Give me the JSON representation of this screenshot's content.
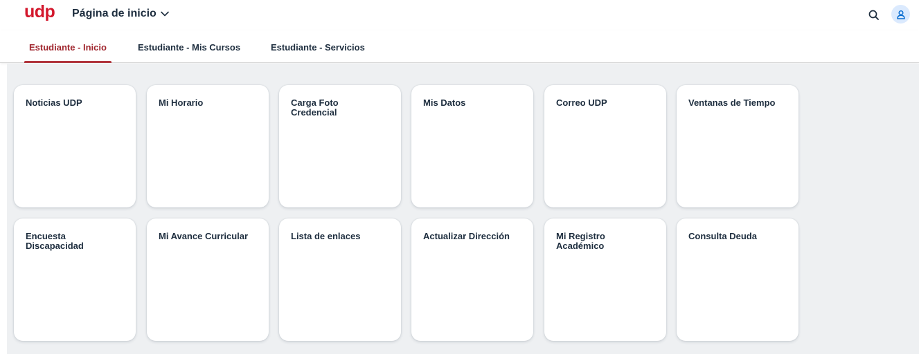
{
  "header": {
    "logo_text": "udp",
    "app_title": "Página de inicio",
    "brand_color": "#d3172c",
    "search_icon": "search-icon",
    "user_icon": "user-icon"
  },
  "tabs": [
    {
      "label": "Estudiante - Inicio",
      "active": true
    },
    {
      "label": "Estudiante - Mis Cursos",
      "active": false
    },
    {
      "label": "Estudiante - Servicios",
      "active": false
    }
  ],
  "tiles": [
    {
      "title": "Noticias UDP"
    },
    {
      "title": "Mi Horario"
    },
    {
      "title": "Carga Foto\nCredencial"
    },
    {
      "title": "Mis Datos"
    },
    {
      "title": "Correo UDP"
    },
    {
      "title": "Ventanas de Tiempo"
    },
    {
      "title": "Encuesta\nDiscapacidad"
    },
    {
      "title": "Mi Avance Curricular"
    },
    {
      "title": "Lista de enlaces"
    },
    {
      "title": "Actualizar Dirección"
    },
    {
      "title": "Mi Registro\nAcadémico"
    },
    {
      "title": "Consulta Deuda"
    }
  ]
}
